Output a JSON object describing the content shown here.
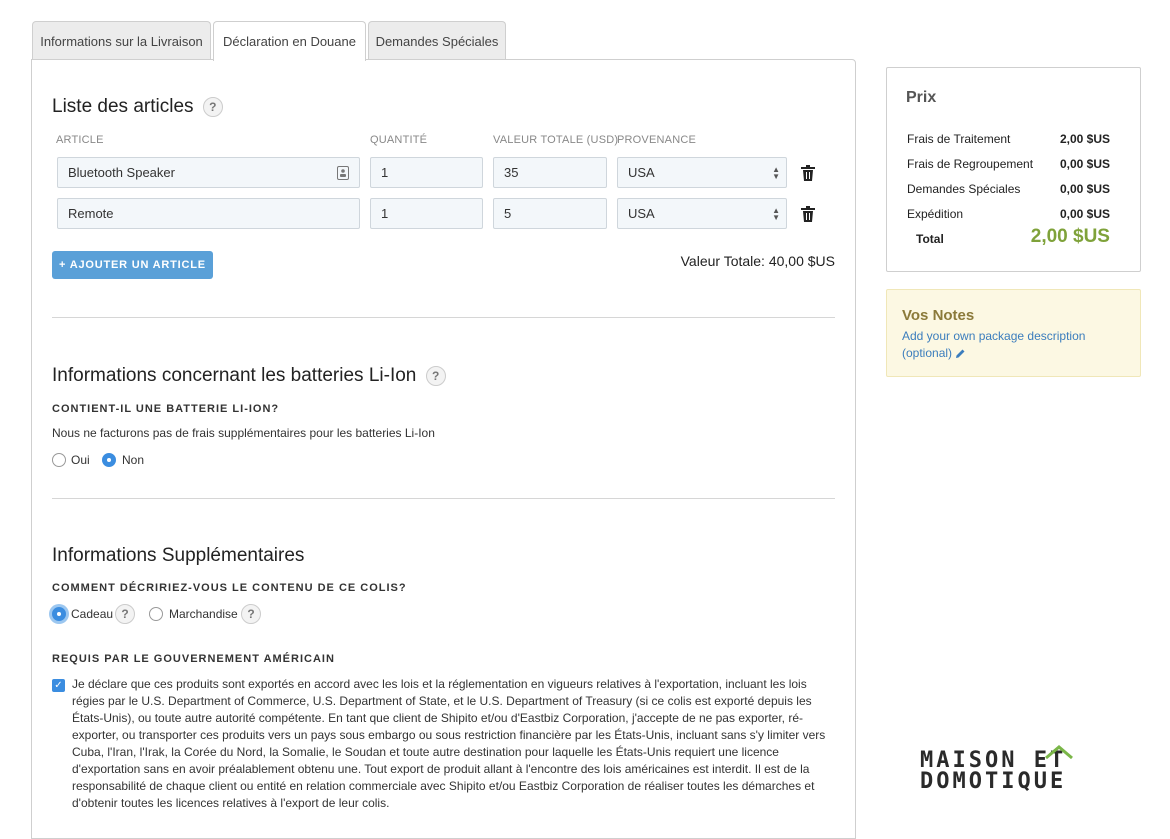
{
  "tabs": [
    {
      "label": "Informations sur la Livraison"
    },
    {
      "label": "Déclaration en Douane"
    },
    {
      "label": "Demandes Spéciales"
    }
  ],
  "articles": {
    "title": "Liste des articles",
    "help": "?",
    "columns": {
      "article": "ARTICLE",
      "quantity": "QUANTITÉ",
      "value": "VALEUR TOTALE (USD)",
      "origin": "PROVENANCE"
    },
    "rows": [
      {
        "name": "Bluetooth Speaker",
        "quantity": "1",
        "value": "35",
        "origin": "USA"
      },
      {
        "name": "Remote",
        "quantity": "1",
        "value": "5",
        "origin": "USA"
      }
    ],
    "add_label": "+ AJOUTER UN ARTICLE",
    "total": "Valeur Totale: 40,00 $US"
  },
  "battery": {
    "title": "Informations concernant les batteries Li-Ion",
    "help": "?",
    "question": "CONTIENT-IL UNE BATTERIE LI-ION?",
    "note": "Nous ne facturons pas de frais supplémentaires pour les batteries Li-Ion",
    "options": [
      {
        "label": "Oui",
        "selected": false
      },
      {
        "label": "Non",
        "selected": true
      }
    ]
  },
  "extra": {
    "title": "Informations Supplémentaires",
    "question": "COMMENT DÉCRIRIEZ-VOUS LE CONTENU DE CE COLIS?",
    "options": [
      {
        "label": "Cadeau",
        "selected": true,
        "help": "?"
      },
      {
        "label": "Marchandise",
        "selected": false,
        "help": "?"
      }
    ],
    "gov_label": "REQUIS PAR LE GOUVERNEMENT AMÉRICAIN",
    "declaration_checked": true,
    "declaration": "Je déclare que ces produits sont exportés en accord avec les lois et la réglementation en vigueurs relatives à l'exportation, incluant les lois régies par le U.S. Department of Commerce, U.S. Department of State, et le U.S. Department of Treasury (si ce colis est exporté depuis les États-Unis), ou toute autre autorité compétente. En tant que client de Shipito et/ou d'Eastbiz Corporation, j'accepte de ne pas exporter, ré-exporter, ou transporter ces produits vers un pays sous embargo ou sous restriction financière par les États-Unis, incluant sans s'y limiter vers Cuba, l'Iran, l'Irak, la Corée du Nord, la Somalie, le Soudan et toute autre destination pour laquelle les États-Unis requiert une licence d'exportation sans en avoir préalablement obtenu une. Tout export de produit allant à l'encontre des lois américaines est interdit. Il est de la responsabilité de chaque client ou entité en relation commerciale avec Shipito et/ou Eastbiz Corporation de réaliser toutes les démarches et d'obtenir toutes les licences relatives à l'export de leur colis."
  },
  "price": {
    "title": "Prix",
    "rows": [
      {
        "label": "Frais de Traitement",
        "value": "2,00 $US"
      },
      {
        "label": "Frais de Regroupement",
        "value": "0,00 $US"
      },
      {
        "label": "Demandes Spéciales",
        "value": "0,00 $US"
      },
      {
        "label": "Expédition",
        "value": "0,00 $US"
      }
    ],
    "total_label": "Total",
    "total_value": "2,00 $US",
    "total_color": "#7fa23a"
  },
  "notes": {
    "title": "Vos Notes",
    "link": "Add your own package description",
    "link2": "(optional)"
  },
  "logo": {
    "line1": "MAISON ET",
    "line2": "DOMOTIQUE"
  },
  "colors": {
    "accent": "#3b8de0",
    "button": "#5aa0d8",
    "link": "#3b7dbd"
  }
}
